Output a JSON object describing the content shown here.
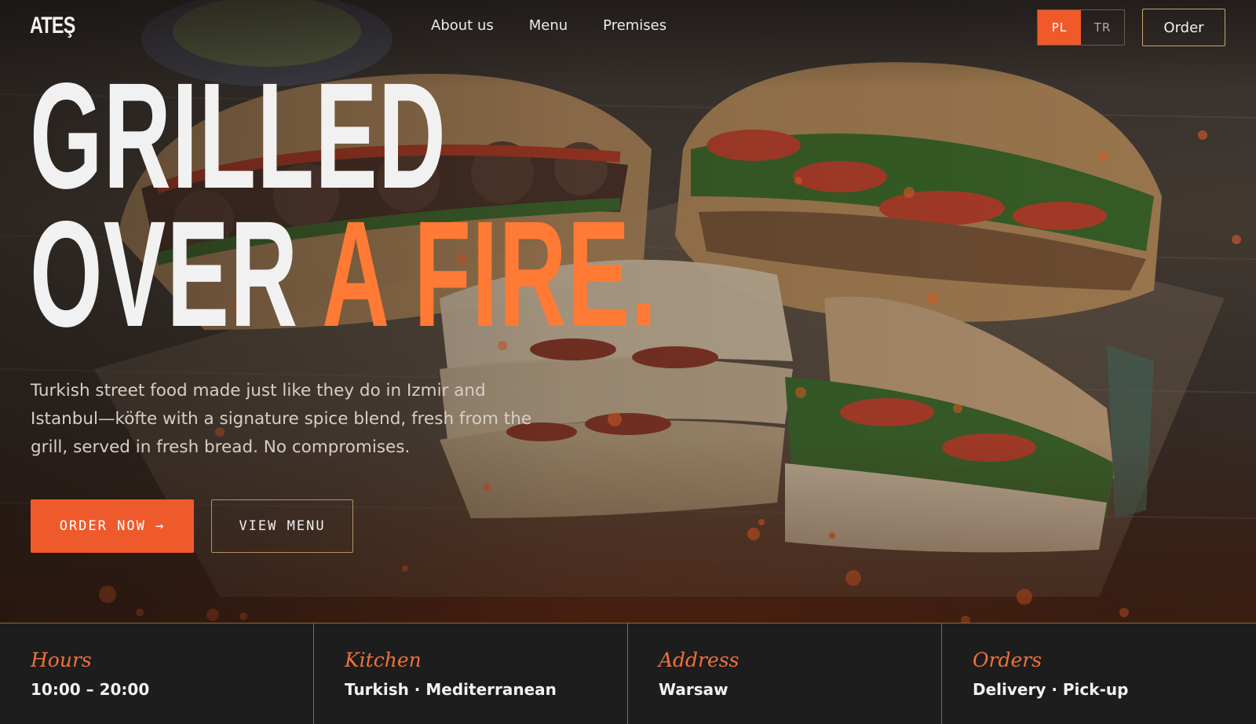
{
  "brand": {
    "logo": "ATEŞ"
  },
  "nav": {
    "links": [
      "About us",
      "Menu",
      "Premises"
    ],
    "languages": [
      {
        "code": "PL",
        "active": true
      },
      {
        "code": "TR",
        "active": false
      }
    ],
    "order_label": "Order"
  },
  "hero": {
    "headline_line1": "GRILLED",
    "headline_line2_plain": "OVER ",
    "headline_line2_accent": "A FIRE.",
    "lead": "Turkish street food made just like they do in Izmir and Istanbul—köfte with a signature spice blend, fresh from the grill, served in fresh bread. No compromises.",
    "cta_primary": "ORDER NOW →",
    "cta_secondary": "VIEW MENU"
  },
  "info": [
    {
      "label": "Hours",
      "value": "10:00 – 20:00"
    },
    {
      "label": "Kitchen",
      "value": "Turkish · Mediterranean"
    },
    {
      "label": "Address",
      "value": "Warsaw"
    },
    {
      "label": "Orders",
      "value": "Delivery · Pick-up"
    }
  ],
  "colors": {
    "accent": "#ef5a2d",
    "headline_accent": "#ff7a34",
    "gold_border": "#c9a66b",
    "info_bg": "#1d1d1d"
  }
}
